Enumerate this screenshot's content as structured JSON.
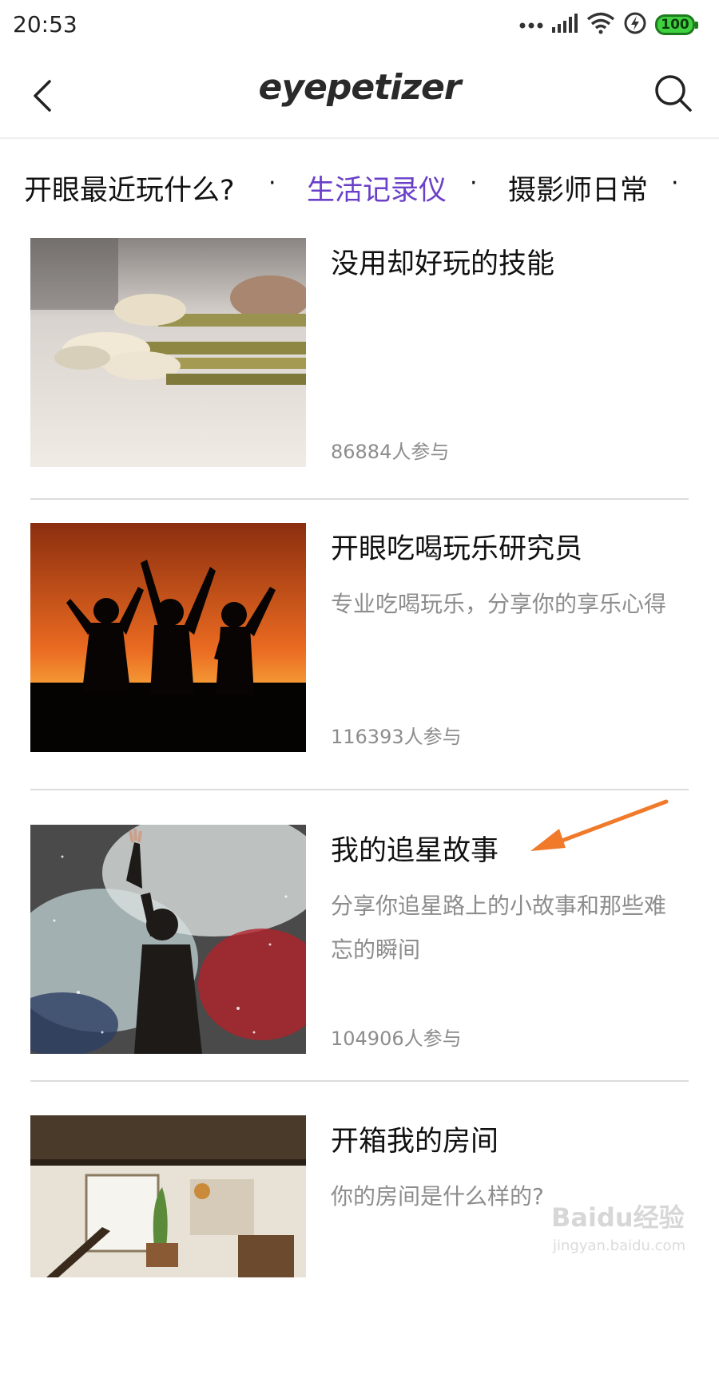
{
  "status_bar": {
    "time": "20:53",
    "battery": "100",
    "battery_color": "#3fd13f"
  },
  "header": {
    "logo": "eyepetizer",
    "back_icon": "chevron-left-icon",
    "search_icon": "search-icon"
  },
  "tabs": [
    {
      "label": "开眼最近玩什么?"
    },
    {
      "label": "生活记录仪",
      "active": true
    },
    {
      "label": "摄影师日常"
    }
  ],
  "tab_separator": "·",
  "accent_color": "#6a3fc9",
  "items": [
    {
      "title": "没用却好玩的技能",
      "description": "",
      "count": "86884人参与"
    },
    {
      "title": "开眼吃喝玩乐研究员",
      "description": "专业吃喝玩乐，分享你的享乐心得",
      "count": "116393人参与"
    },
    {
      "title": "我的追星故事",
      "description": "分享你追星路上的小故事和那些难忘的瞬间",
      "count": "104906人参与"
    },
    {
      "title": "开箱我的房间",
      "description": "你的房间是什么样的?",
      "count": ""
    }
  ],
  "annotation_arrow_color": "#f07a2a",
  "watermark": {
    "brand": "Baidu经验",
    "url": "jingyan.baidu.com"
  }
}
